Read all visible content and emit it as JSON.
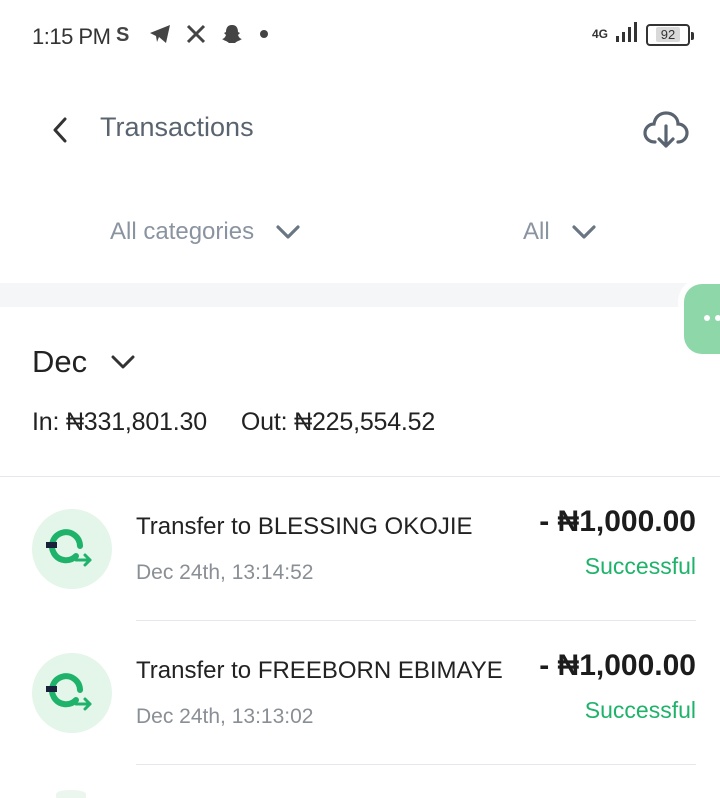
{
  "status_bar": {
    "time": "1:15 PM",
    "network": "4G",
    "battery": "92"
  },
  "header": {
    "title": "Transactions"
  },
  "filters": {
    "category": "All categories",
    "type": "All"
  },
  "summary": {
    "month": "Dec",
    "in_label": "In: ₦331,801.30",
    "out_label": "Out: ₦225,554.52"
  },
  "transactions": [
    {
      "title": "Transfer to BLESSING OKOJIE",
      "date": "Dec 24th, 13:14:52",
      "amount": "- ₦1,000.00",
      "status": "Successful"
    },
    {
      "title": "Transfer to FREEBORN EBIMAYE ...",
      "date": "Dec 24th, 13:13:02",
      "amount": "- ₦1,000.00",
      "status": "Successful"
    }
  ],
  "colors": {
    "accent_green": "#1fb26a",
    "avatar_bg": "#e4f5ea",
    "title_gray": "#5a6470",
    "filter_gray": "#8a94a0"
  }
}
